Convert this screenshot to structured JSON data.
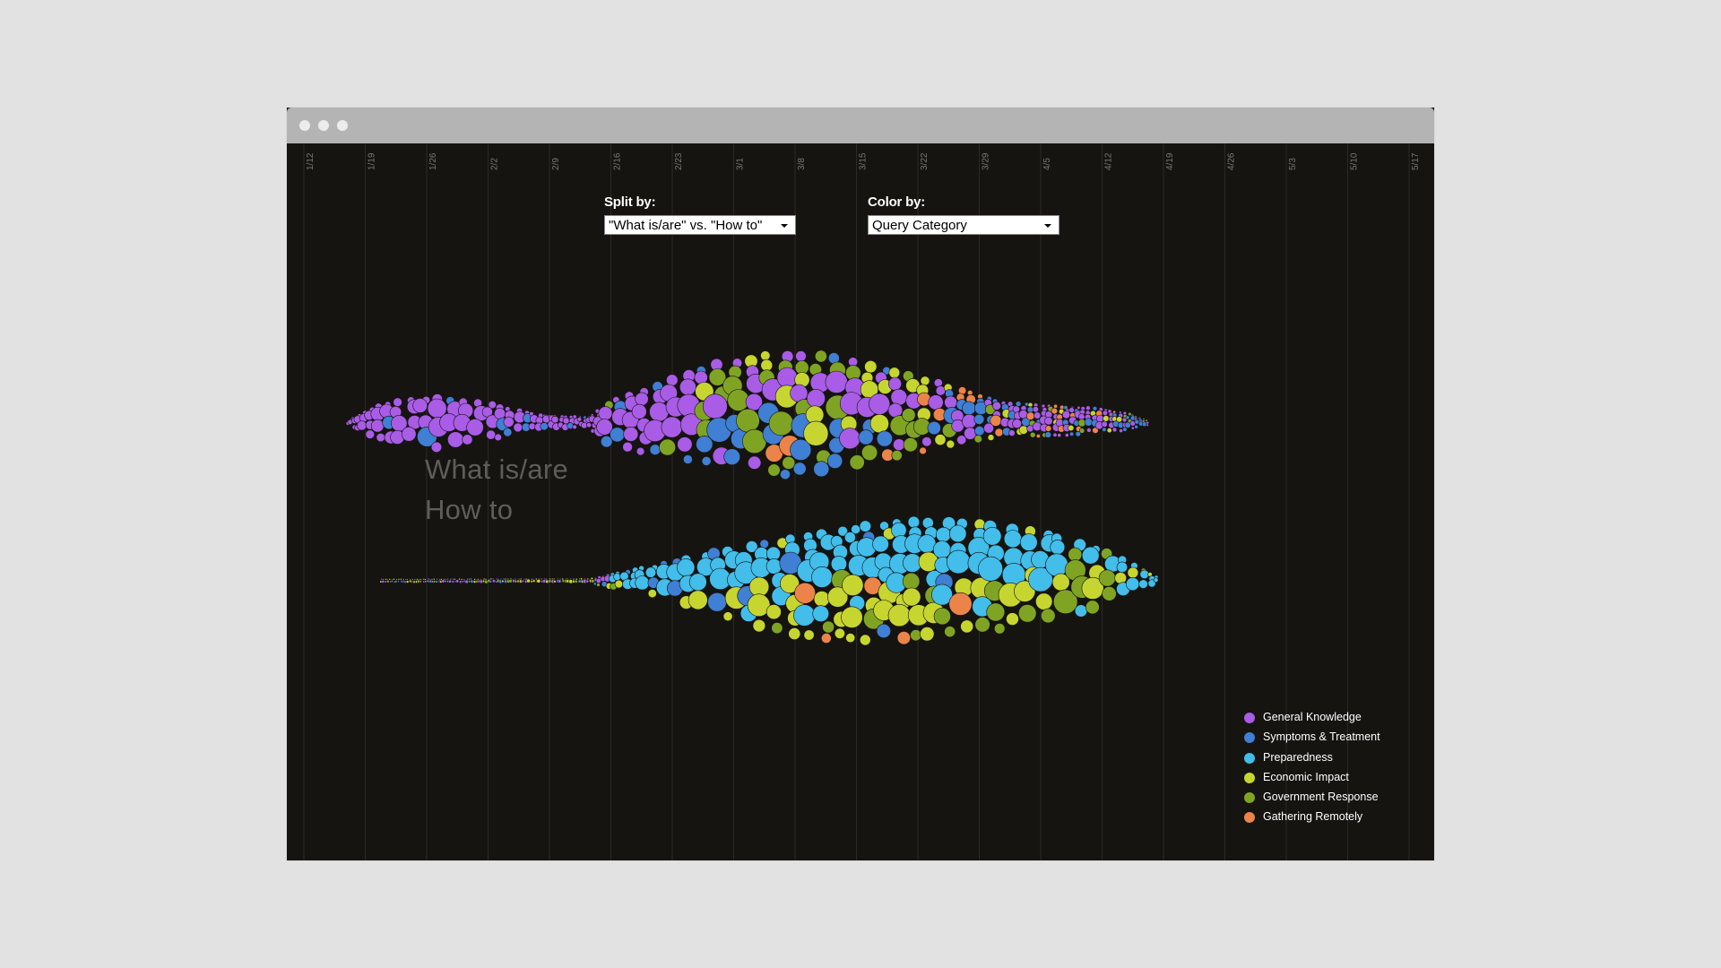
{
  "window": {
    "controls": [
      "close",
      "minimize",
      "maximize"
    ]
  },
  "timeline": {
    "dates": [
      "1/12",
      "1/19",
      "1/26",
      "2/2",
      "2/9",
      "2/16",
      "2/23",
      "3/1",
      "3/8",
      "3/15",
      "3/22",
      "3/29",
      "4/5",
      "4/12",
      "4/19",
      "4/26",
      "5/3",
      "5/10",
      "5/17"
    ]
  },
  "controls": {
    "split": {
      "label": "Split by:",
      "value": "\"What is/are\" vs. \"How to\""
    },
    "color": {
      "label": "Color by:",
      "value": "Query Category"
    }
  },
  "groups": [
    {
      "label": "What is/are"
    },
    {
      "label": "How to"
    }
  ],
  "legend": {
    "items": [
      {
        "label": "General Knowledge",
        "color": "#a95ce6"
      },
      {
        "label": "Symptoms & Treatment",
        "color": "#3f7fd4"
      },
      {
        "label": "Preparedness",
        "color": "#43bdea"
      },
      {
        "label": "Economic Impact",
        "color": "#c7d530"
      },
      {
        "label": "Government Response",
        "color": "#7fa424"
      },
      {
        "label": "Gathering Remotely",
        "color": "#ec844a"
      }
    ]
  }
}
